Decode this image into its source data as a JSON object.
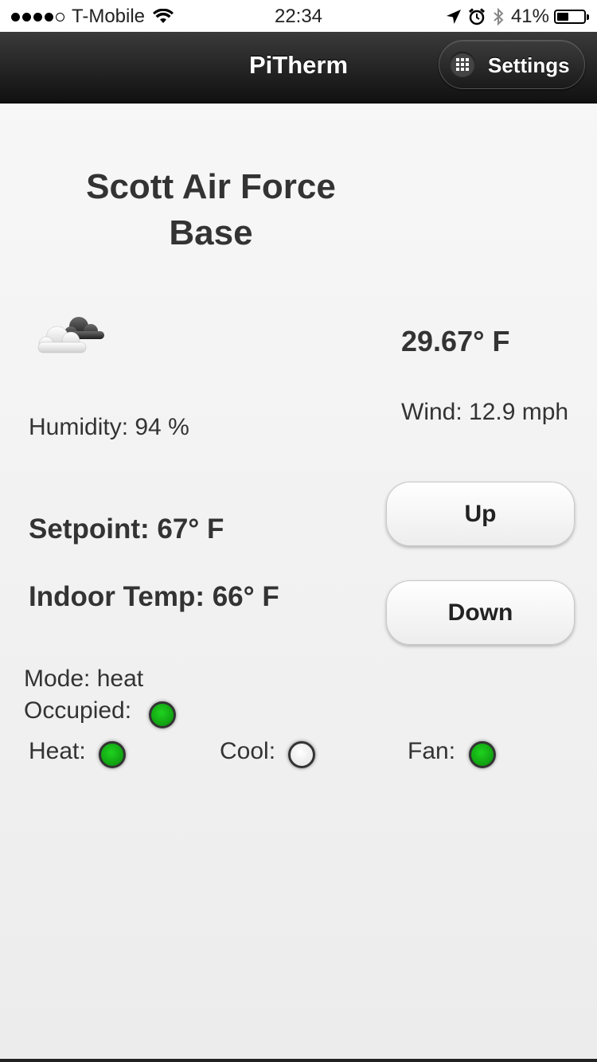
{
  "status_bar": {
    "signal_dots": [
      true,
      true,
      true,
      true,
      false
    ],
    "carrier": "T-Mobile",
    "time": "22:34",
    "battery": "41%"
  },
  "header": {
    "title": "PiTherm",
    "settings_label": "Settings",
    "settings_icon": "grid-icon"
  },
  "weather": {
    "location": "Scott Air Force Base",
    "icon": "cloudy-icon",
    "temperature": "29.67° F",
    "humidity": "Humidity: 94 %",
    "wind": "Wind: 12.9 mph"
  },
  "thermostat": {
    "setpoint": "Setpoint: 67° F",
    "indoor_temp": "Indoor Temp: 66° F",
    "up_label": "Up",
    "down_label": "Down",
    "mode": "Mode: heat",
    "occupied_label": "Occupied:",
    "occupied_on": true,
    "heat_label": "Heat:",
    "heat_on": true,
    "cool_label": "Cool:",
    "cool_on": false,
    "fan_label": "Fan:",
    "fan_on": true
  },
  "colors": {
    "led_on": "#12b012",
    "led_off": "#f2f2f2",
    "header": "#1a1a1a"
  }
}
